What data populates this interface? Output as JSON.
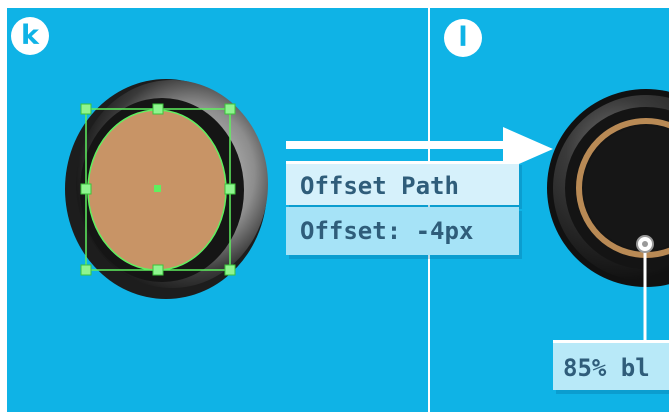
{
  "panel_k": {
    "badge": "k",
    "path_operation": "Offset Path",
    "offset_setting": "Offset: -4px"
  },
  "panel_l": {
    "badge": "l",
    "blend_label": "85% bl"
  },
  "colors": {
    "background": "#0fb3e6",
    "divider": "#ffffff",
    "inner_fill": "#c89466",
    "selection": "#5ff05f",
    "ring_gold": "#b98a55",
    "label_bg_light": "#d6f1fb",
    "label_bg_mid": "#a6e3f7",
    "label_text": "#2f5d7a"
  }
}
